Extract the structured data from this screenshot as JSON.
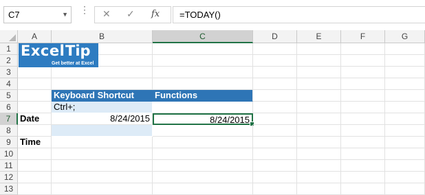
{
  "formula_bar": {
    "name_box": "C7",
    "name_box_arrow": "▼",
    "more_icon": "⋮",
    "cancel_icon": "✕",
    "enter_icon": "✓",
    "function_icon": "fx",
    "formula": "=TODAY()"
  },
  "columns": [
    "A",
    "B",
    "C",
    "D",
    "E",
    "F",
    "G"
  ],
  "rows": [
    "1",
    "2",
    "3",
    "4",
    "5",
    "6",
    "7",
    "8",
    "9",
    "10",
    "11",
    "12",
    "13"
  ],
  "selected_cell": {
    "column": "C",
    "row": "7"
  },
  "logo": {
    "word1": "Excel",
    "word2": "Tip",
    "tagline": "Get better at Excel"
  },
  "cells": {
    "B5": "Keyboard Shortcut",
    "C5": "Functions",
    "B6": "Ctrl+;",
    "A7": "Date",
    "B7": "8/24/2015",
    "C7": "8/24/2015",
    "A9": "Time"
  },
  "colors": {
    "header_fill": "#2e75b6",
    "light_fill": "#ddebf7",
    "selection": "#217346"
  }
}
